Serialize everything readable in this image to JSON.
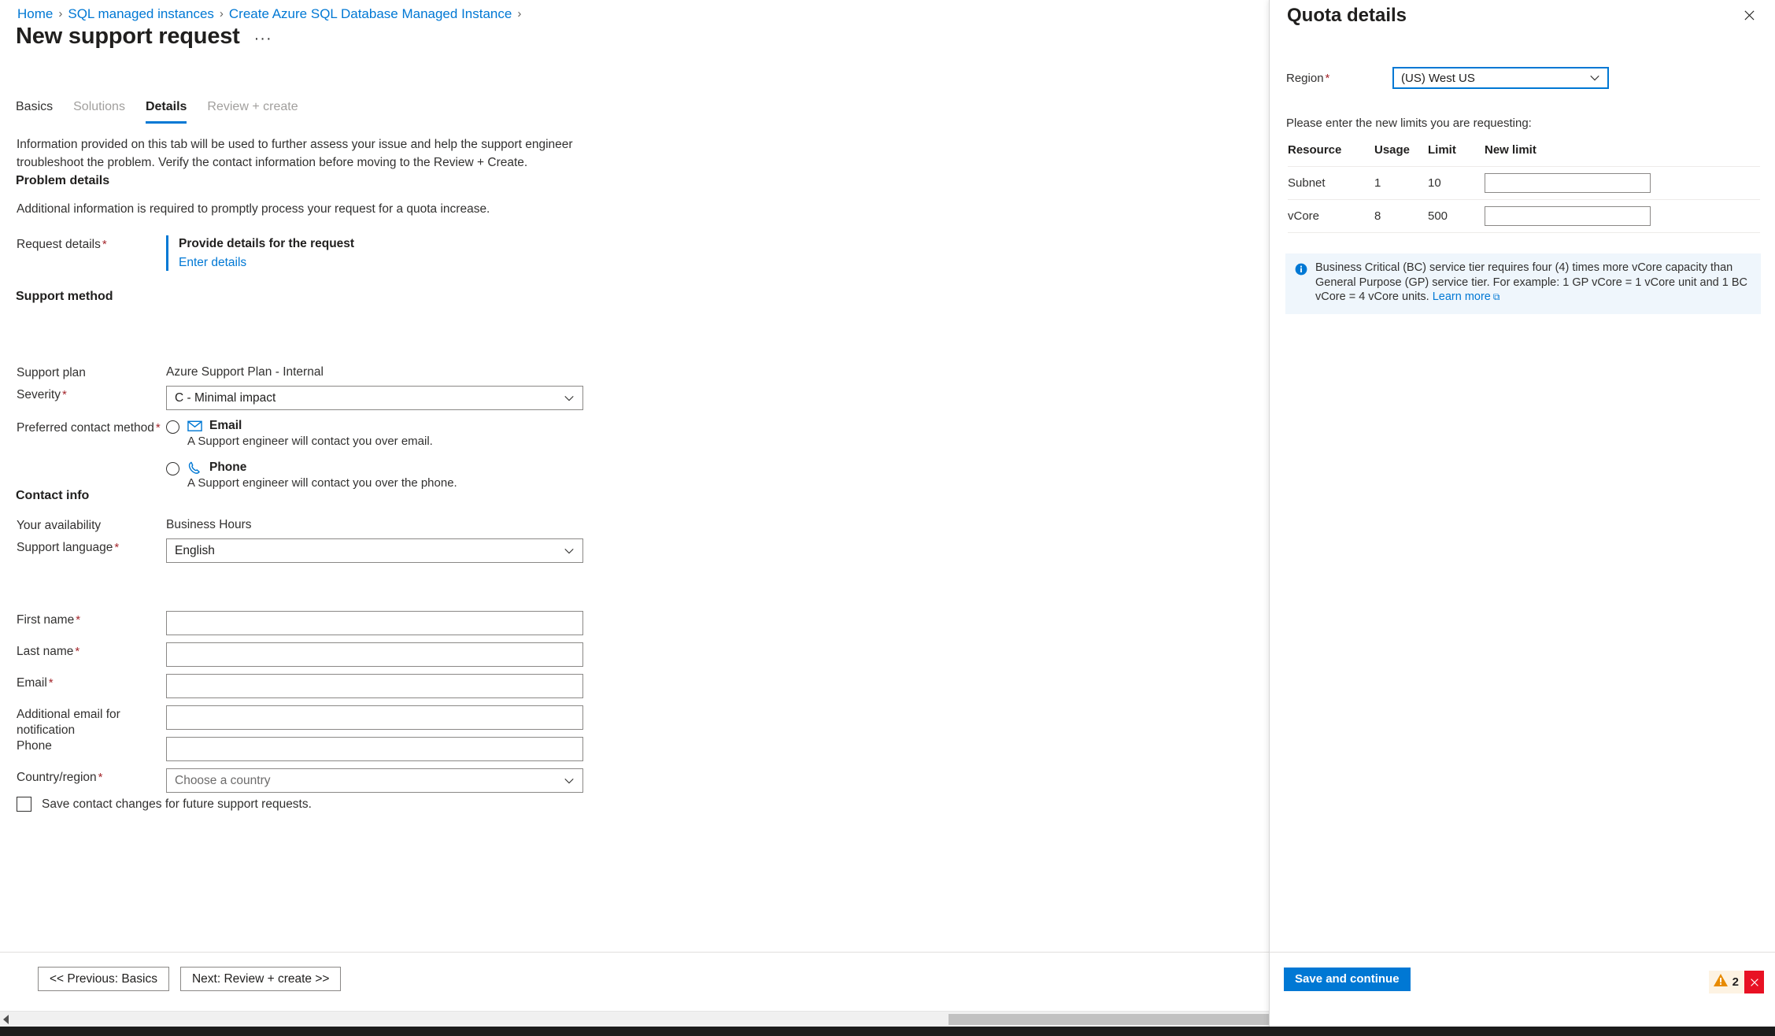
{
  "breadcrumb": {
    "items": [
      "Home",
      "SQL managed instances",
      "Create Azure SQL Database Managed Instance"
    ],
    "separator": "›"
  },
  "header": {
    "title": "New support request",
    "more_label": "···"
  },
  "tabs": [
    {
      "label": "Basics",
      "state": "enabled"
    },
    {
      "label": "Solutions",
      "state": "disabled"
    },
    {
      "label": "Details",
      "state": "active"
    },
    {
      "label": "Review + create",
      "state": "disabled"
    }
  ],
  "main": {
    "intro": "Information provided on this tab will be used to further assess your issue and help the support engineer troubleshoot the problem. Verify the contact information before moving to the Review + Create.",
    "problem_details": {
      "heading": "Problem details",
      "description": "Additional information is required to promptly process your request for a quota increase.",
      "request_details_label": "Request details",
      "callout_title": "Provide details for the request",
      "callout_link": "Enter details"
    },
    "support_method": {
      "heading": "Support method",
      "support_plan_label": "Support plan",
      "support_plan_value": "Azure Support Plan - Internal",
      "severity_label": "Severity",
      "severity_value": "C - Minimal impact",
      "contact_method_label": "Preferred contact method",
      "options": [
        {
          "icon": "email-icon",
          "title": "Email",
          "description": "A Support engineer will contact you over email.",
          "selected": false
        },
        {
          "icon": "phone-icon",
          "title": "Phone",
          "description": "A Support engineer will contact you over the phone.",
          "selected": false
        }
      ],
      "availability_label": "Your availability",
      "availability_value": "Business Hours",
      "language_label": "Support language",
      "language_value": "English"
    },
    "contact_info": {
      "heading": "Contact info",
      "fields": [
        {
          "label": "First name",
          "required": true,
          "value": "",
          "placeholder": ""
        },
        {
          "label": "Last name",
          "required": true,
          "value": "",
          "placeholder": ""
        },
        {
          "label": "Email",
          "required": true,
          "value": "",
          "placeholder": ""
        },
        {
          "label": "Additional email for notification",
          "required": false,
          "value": "",
          "placeholder": ""
        },
        {
          "label": "Phone",
          "required": false,
          "value": "",
          "placeholder": ""
        }
      ],
      "country_label": "Country/region",
      "country_placeholder": "Choose a country",
      "save_checkbox_label": "Save contact changes for future support requests.",
      "save_checkbox_checked": false
    },
    "footer": {
      "previous_label": "<< Previous: Basics",
      "next_label": "Next: Review + create >>"
    }
  },
  "panel": {
    "title": "Quota details",
    "close_icon": "close-icon",
    "region_label": "Region",
    "region_value": "(US) West US",
    "instruction": "Please enter the new limits you are requesting:",
    "table": {
      "columns": [
        "Resource",
        "Usage",
        "Limit",
        "New limit"
      ],
      "rows": [
        {
          "resource": "Subnet",
          "usage": "1",
          "limit": "10",
          "new_limit": "",
          "new_limit_placeholder": ""
        },
        {
          "resource": "vCore",
          "usage": "8",
          "limit": "500",
          "new_limit": "",
          "new_limit_placeholder": ""
        }
      ]
    },
    "info": {
      "icon": "info-icon",
      "text": "Business Critical (BC) service tier requires four (4) times more vCore capacity than General Purpose (GP) service tier. For example: 1 GP vCore = 1 vCore unit and 1 BC vCore = 4 vCore units. ",
      "link_label": "Learn more",
      "link_external_glyph": "⧉"
    },
    "save_label": "Save and continue"
  },
  "notifications": {
    "warning_icon": "warning-triangle-icon",
    "warning_count": "2",
    "close_icon": "close-icon"
  },
  "colors": {
    "accent": "#0078d4",
    "required": "#a4262c",
    "warning_bg": "#fdf3e3",
    "error_bg": "#e81123",
    "info_bg": "#eff6fc"
  }
}
